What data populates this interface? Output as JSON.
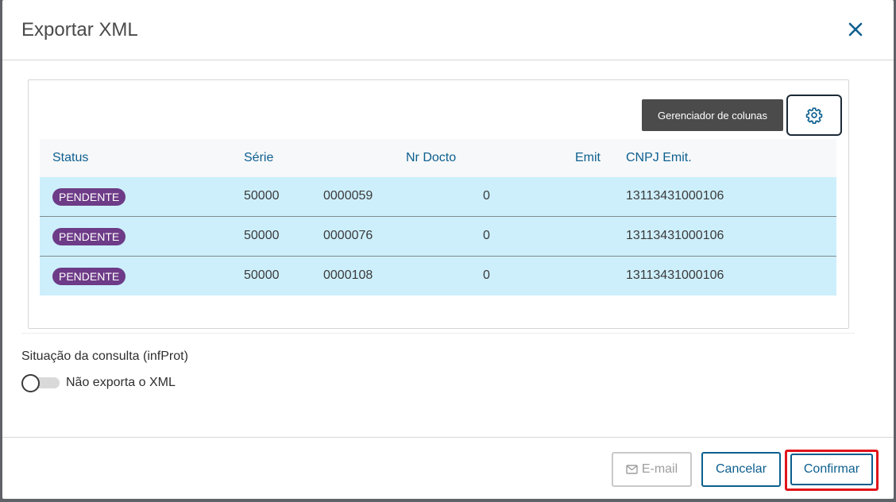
{
  "modal": {
    "title": "Exportar XML"
  },
  "table": {
    "tooltip": "Gerenciador de colunas",
    "columns": [
      "Status",
      "Série",
      "Nr Docto",
      "Emit",
      "CNPJ Emit."
    ],
    "rows": [
      {
        "status": "PENDENTE",
        "serie": "50000",
        "nr_docto": "0000059",
        "emit": "0",
        "cnpj": "13113431000106"
      },
      {
        "status": "PENDENTE",
        "serie": "50000",
        "nr_docto": "0000076",
        "emit": "0",
        "cnpj": "13113431000106"
      },
      {
        "status": "PENDENTE",
        "serie": "50000",
        "nr_docto": "0000108",
        "emit": "0",
        "cnpj": "13113431000106"
      }
    ]
  },
  "options": {
    "section_label": "Situação da consulta (infProt)",
    "switch_label": "Não exporta o XML"
  },
  "footer": {
    "email_label": "E-mail",
    "cancel_label": "Cancelar",
    "confirm_label": "Confirmar"
  },
  "colors": {
    "primary": "#0c5f8f",
    "badge": "#6d3b87",
    "row_highlight": "#cdeffc",
    "highlight_border": "#e0151b"
  }
}
